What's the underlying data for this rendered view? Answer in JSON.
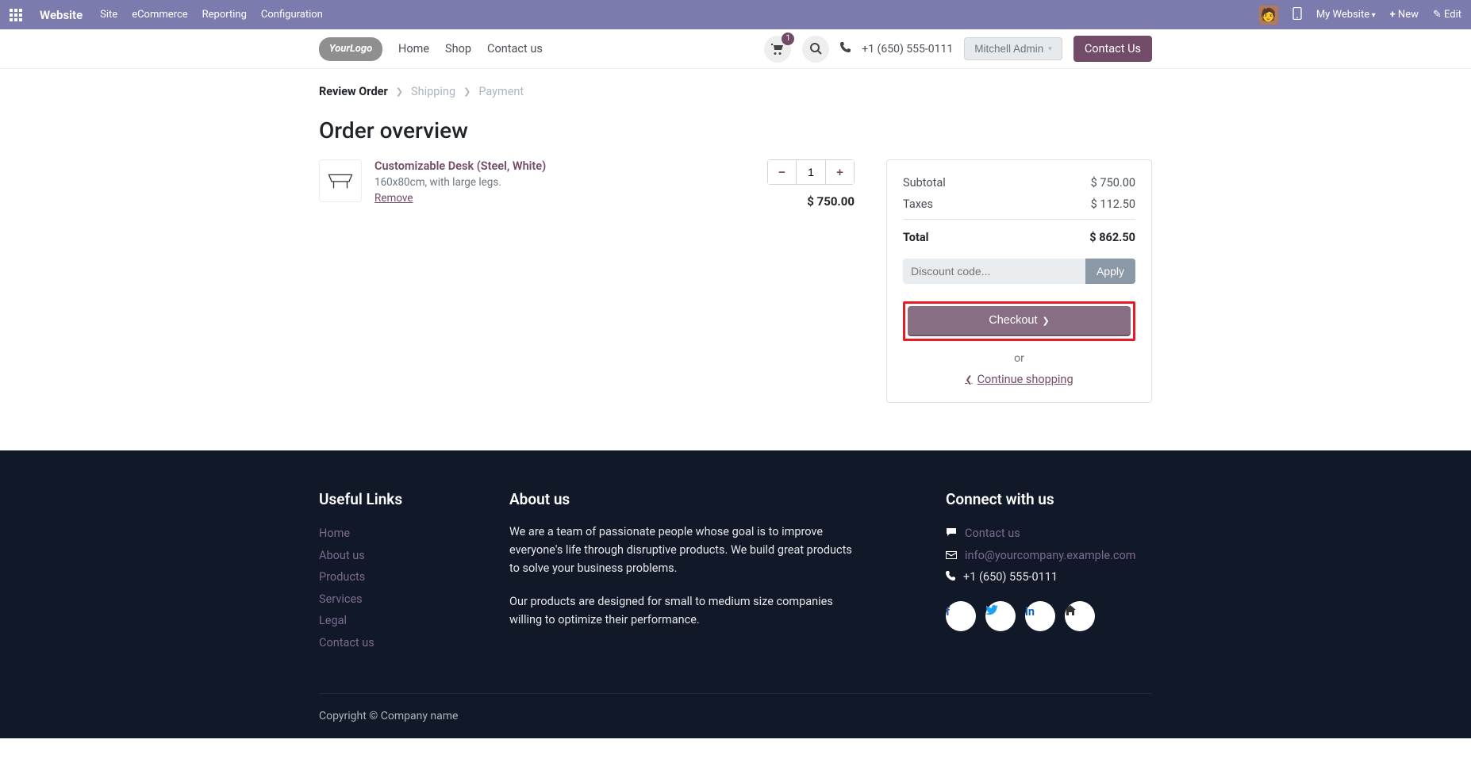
{
  "topbar": {
    "brand": "Website",
    "menu": [
      "Site",
      "eCommerce",
      "Reporting",
      "Configuration"
    ],
    "websiteSelector": "My Website",
    "new_label": "New",
    "edit_label": "Edit"
  },
  "header": {
    "nav": {
      "home": "Home",
      "shop": "Shop",
      "contact": "Contact us"
    },
    "cart_count": "1",
    "phone": "+1 (650) 555-0111",
    "user_name": "Mitchell Admin",
    "contact_button": "Contact Us"
  },
  "breadcrumb": {
    "review": "Review Order",
    "shipping": "Shipping",
    "payment": "Payment"
  },
  "page_title": "Order overview",
  "line": {
    "title": "Customizable Desk (Steel, White)",
    "desc": "160x80cm, with large legs.",
    "remove": "Remove",
    "qty": "1",
    "price": "$ 750.00"
  },
  "summary": {
    "subtotal_label": "Subtotal",
    "subtotal_value": "$ 750.00",
    "taxes_label": "Taxes",
    "taxes_value": "$ 112.50",
    "total_label": "Total",
    "total_value": "$ 862.50",
    "discount_placeholder": "Discount code...",
    "apply_label": "Apply",
    "checkout_label": "Checkout",
    "or_label": "or",
    "continue_label": "Continue shopping"
  },
  "footer": {
    "useful_heading": "Useful Links",
    "links": {
      "home": "Home",
      "about": "About us",
      "products": "Products",
      "services": "Services",
      "legal": "Legal",
      "contact": "Contact us"
    },
    "about_heading": "About us",
    "about_p1": "We are a team of passionate people whose goal is to improve everyone's life through disruptive products. We build great products to solve your business problems.",
    "about_p2": "Our products are designed for small to medium size companies willing to optimize their performance.",
    "connect_heading": "Connect with us",
    "contact_link": "Contact us",
    "email": "info@yourcompany.example.com",
    "phone": "+1 (650) 555-0111",
    "copyright": "Copyright © Company name"
  }
}
